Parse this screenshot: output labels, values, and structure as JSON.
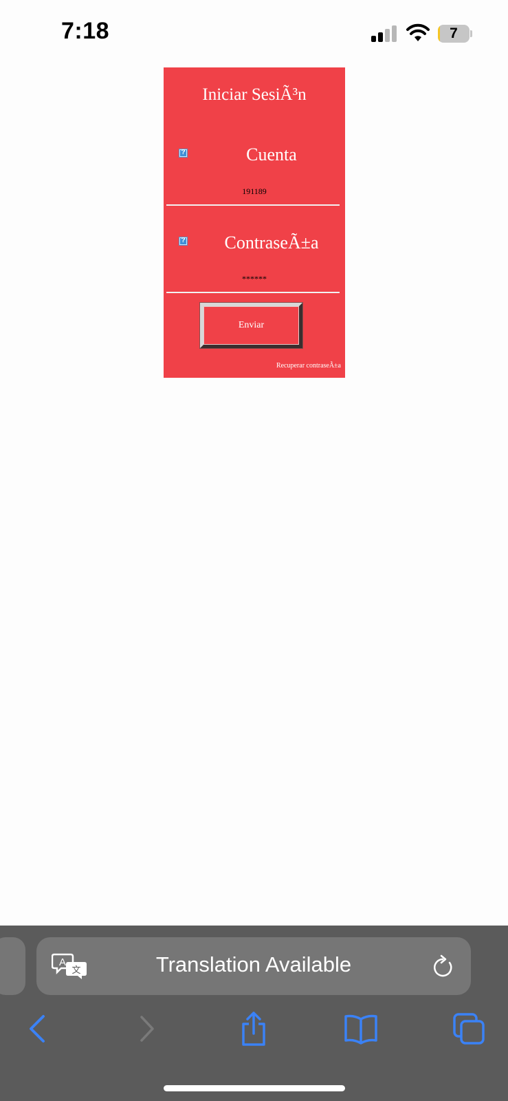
{
  "status_bar": {
    "time": "7:18",
    "battery_level": "7",
    "battery_fraction": 0.07,
    "signal_bars_filled": 2,
    "signal_bars_total": 4,
    "icons": [
      "signal-icon",
      "wifi-icon",
      "battery-icon"
    ]
  },
  "login": {
    "title": "Iniciar SesiÃ³n",
    "account_label": "Cuenta",
    "account_value": "191189",
    "password_label": "ContraseÃ±a",
    "password_value": "******",
    "submit_label": "Enviar",
    "recover_link": "Recuperar contraseÃ±a",
    "background_color": "#f04148",
    "icons": [
      "broken-image-icon"
    ]
  },
  "browser": {
    "address_text": "Translation Available",
    "icons": [
      "translate-icon",
      "reload-icon",
      "back-icon",
      "forward-icon",
      "share-icon",
      "bookmarks-icon",
      "tabs-icon"
    ],
    "toolbar_color": "#5b5b5b",
    "accent_color": "#3b82f6"
  }
}
